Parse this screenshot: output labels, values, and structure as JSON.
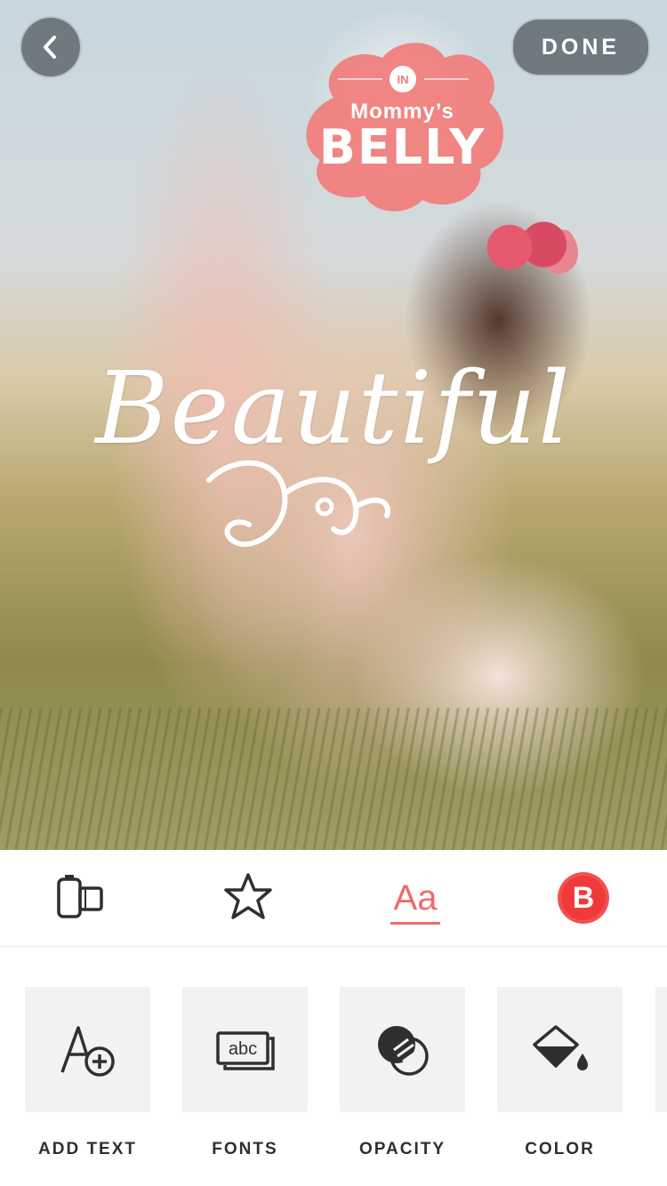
{
  "header": {
    "done_label": "DONE"
  },
  "canvas": {
    "sticker": {
      "badge": "IN",
      "line1": "Mommy’s",
      "line2": "BELLY",
      "color": "#f07f7d"
    },
    "headline_text": "Beautiful"
  },
  "toolbar": {
    "items": [
      {
        "icon": "filmstrip-icon"
      },
      {
        "icon": "sparkle-star-icon"
      },
      {
        "icon": "text-icon",
        "label": "Aa",
        "active": true
      },
      {
        "icon": "sticker-badge-icon",
        "label": "B"
      }
    ],
    "accent": "#ef6b6b"
  },
  "options": [
    {
      "label": "ADD TEXT",
      "icon": "add-text-icon"
    },
    {
      "label": "FONTS",
      "icon": "fonts-icon"
    },
    {
      "label": "OPACITY",
      "icon": "opacity-icon"
    },
    {
      "label": "COLOR",
      "icon": "paint-bucket-icon"
    }
  ]
}
